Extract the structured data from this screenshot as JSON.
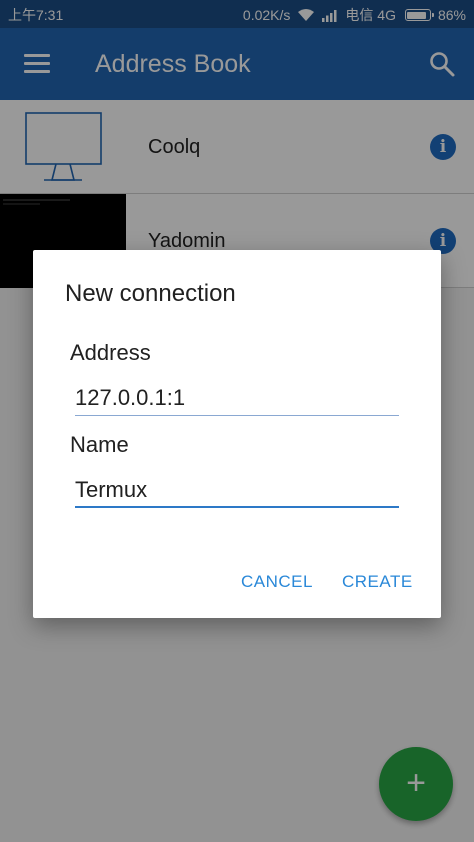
{
  "status_bar": {
    "time": "上午7:31",
    "speed": "0.02K/s",
    "carrier": "电信 4G",
    "battery": "86%"
  },
  "app_bar": {
    "title": "Address Book",
    "menu_icon": "hamburger-menu-icon",
    "search_icon": "search-icon"
  },
  "connections": [
    {
      "name": "Coolq",
      "thumbnail": "monitor-icon"
    },
    {
      "name": "Yadomin",
      "thumbnail": "screenshot-thumbnail"
    }
  ],
  "dialog": {
    "title": "New connection",
    "address_label": "Address",
    "address_value": "127.0.0.1:1",
    "name_label": "Name",
    "name_value": "Termux",
    "cancel_label": "CANCEL",
    "create_label": "CREATE"
  },
  "fab": {
    "label": "+"
  },
  "colors": {
    "status_bar": "#1c4e86",
    "app_bar": "#2266b3",
    "accent": "#2a88d8",
    "fab": "#28a745"
  }
}
